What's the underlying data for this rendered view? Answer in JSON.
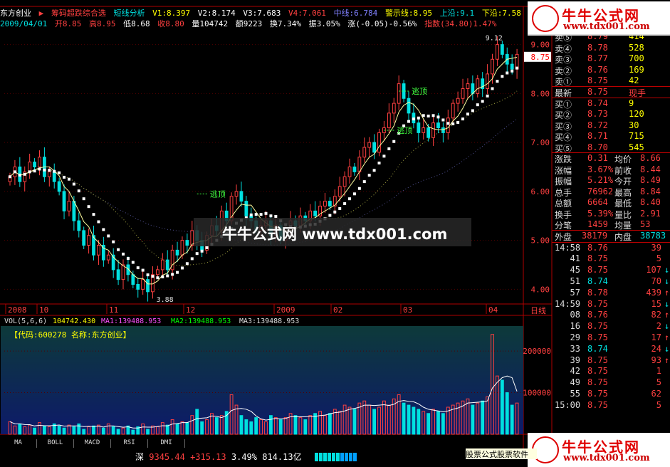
{
  "header": {
    "stock_name": "东方创业",
    "indicator_name": "筹码超跌综合选",
    "indicator_sub": "短线分析",
    "v1": "V1:8.397",
    "v2": "V2:8.174",
    "v3": "V3:7.683",
    "v4": "V4:7.061",
    "mid": "中线:6.784",
    "alert": "警示线:8.95",
    "upper": "上沿:9.1",
    "lower": "下沿:7.58",
    "date": "2009/04/01",
    "open": "开8.85",
    "high": "高8.95",
    "low": "低8.68",
    "close": "收8.80",
    "volume": "量104742",
    "amount": "额9223",
    "turnover": "换7.34%",
    "amplitude": "振3.05%",
    "change": "涨(-0.05)-0.56%",
    "index": "指数(34.80)1.47%"
  },
  "price_axis": {
    "ticks": [
      "9.00",
      "8.00",
      "7.00",
      "6.00",
      "5.00",
      "4.00"
    ],
    "current_tag": "8.75"
  },
  "annotations": {
    "sell_label": "逃顶",
    "high_label": "9.12",
    "low_label": "3.88"
  },
  "time_axis": {
    "labels": [
      "2008",
      "10",
      "11",
      "12",
      "2009",
      "02",
      "03",
      "04"
    ],
    "period": "日线"
  },
  "volume_header": {
    "vol": "VOL(5,6,6)",
    "vol_val": "104742.430",
    "ma1": "MA1:139488.953",
    "ma2": "MA2:139488.953",
    "ma3": "MA3:139488.953"
  },
  "volume_info": "【代码:600278 名称:东方创业】",
  "volume_axis": [
    "200000",
    "100000"
  ],
  "quote": {
    "asks": [
      {
        "label": "卖⑤",
        "price": "8.79",
        "vol": "414"
      },
      {
        "label": "卖④",
        "price": "8.78",
        "vol": "528"
      },
      {
        "label": "卖③",
        "price": "8.77",
        "vol": "700"
      },
      {
        "label": "卖②",
        "price": "8.76",
        "vol": "169"
      },
      {
        "label": "卖①",
        "price": "8.75",
        "vol": "42"
      }
    ],
    "last": {
      "label": "最新",
      "price": "8.75",
      "extra": "现手"
    },
    "bids": [
      {
        "label": "买①",
        "price": "8.74",
        "vol": "9"
      },
      {
        "label": "买②",
        "price": "8.73",
        "vol": "120"
      },
      {
        "label": "买③",
        "price": "8.72",
        "vol": "30"
      },
      {
        "label": "买④",
        "price": "8.71",
        "vol": "715"
      },
      {
        "label": "买⑤",
        "price": "8.70",
        "vol": "545"
      }
    ],
    "stats": [
      {
        "l1": "涨跌",
        "v1": "0.31",
        "l2": "均价",
        "v2": "8.66"
      },
      {
        "l1": "涨幅",
        "v1": "3.67%",
        "l2": "前收",
        "v2": "8.44"
      },
      {
        "l1": "振幅",
        "v1": "5.21%",
        "l2": "今开",
        "v2": "8.49"
      },
      {
        "l1": "总手",
        "v1": "76962",
        "l2": "最高",
        "v2": "8.84"
      },
      {
        "l1": "总额",
        "v1": "6664",
        "l2": "最低",
        "v2": "8.40"
      },
      {
        "l1": "换手",
        "v1": "5.39%",
        "l2": "量比",
        "v2": "2.91"
      },
      {
        "l1": "分笔",
        "v1": "1459",
        "l2": "均量",
        "v2": "53"
      }
    ],
    "outer": {
      "l1": "外盘",
      "v1": "38179",
      "l2": "内盘",
      "v2": "38783"
    },
    "ticks": [
      {
        "t": "14:58",
        "p": "8.76",
        "v": "39",
        "d": ""
      },
      {
        "t": "41",
        "p": "8.75",
        "v": "5",
        "d": ""
      },
      {
        "t": "45",
        "p": "8.75",
        "v": "107",
        "d": "↓"
      },
      {
        "t": "51",
        "p": "8.74",
        "v": "70",
        "d": "↓"
      },
      {
        "t": "57",
        "p": "8.78",
        "v": "439",
        "d": "↑"
      },
      {
        "t": "14:59",
        "p": "8.75",
        "v": "15",
        "d": "↓"
      },
      {
        "t": "08",
        "p": "8.76",
        "v": "82",
        "d": "↑"
      },
      {
        "t": "16",
        "p": "8.75",
        "v": "2",
        "d": "↓"
      },
      {
        "t": "29",
        "p": "8.75",
        "v": "17",
        "d": "↑"
      },
      {
        "t": "33",
        "p": "8.74",
        "v": "24",
        "d": "↓"
      },
      {
        "t": "39",
        "p": "8.75",
        "v": "93",
        "d": "↑"
      },
      {
        "t": "42",
        "p": "8.75",
        "v": "1",
        "d": ""
      },
      {
        "t": "49",
        "p": "8.75",
        "v": "5",
        "d": ""
      },
      {
        "t": "55",
        "p": "8.75",
        "v": "62",
        "d": ""
      },
      {
        "t": "15:00",
        "p": "8.75",
        "v": "5",
        "d": ""
      }
    ]
  },
  "logo": {
    "title": "牛牛公式网",
    "url": "www.tdx001.com"
  },
  "watermark": "牛牛公式网 www.tdx001.com",
  "tabs": [
    "MA",
    "BOLL",
    "MACD",
    "RSI",
    "DMI"
  ],
  "status": {
    "market": "深",
    "index": "9345.44",
    "change": "+315.13",
    "pct": "3.49%",
    "amount": "814.13亿"
  },
  "ad": "股票公式股票软件",
  "colors": {
    "up": "#ff4040",
    "down": "#00e0e0",
    "axis": "#b00000",
    "ma": "#ffff00"
  },
  "chart_data": {
    "type": "candlestick",
    "ylim": [
      3.7,
      9.3
    ],
    "closes": [
      6.3,
      6.5,
      6.2,
      6.4,
      6.6,
      6.5,
      6.7,
      6.3,
      6.4,
      6.2,
      6.0,
      5.6,
      5.8,
      5.4,
      5.2,
      4.9,
      5.1,
      4.7,
      4.9,
      4.6,
      4.7,
      4.4,
      4.2,
      4.5,
      4.3,
      4.1,
      4.0,
      4.2,
      3.95,
      4.3,
      4.4,
      4.6,
      4.4,
      4.8,
      4.7,
      5.0,
      4.9,
      5.2,
      5.0,
      4.8,
      5.1,
      5.3,
      5.2,
      5.6,
      5.4,
      5.9,
      6.0,
      5.8,
      5.5,
      5.4,
      5.2,
      5.3,
      5.4,
      5.1,
      5.3,
      5.0,
      5.2,
      5.4,
      5.3,
      5.5,
      5.4,
      5.6,
      5.5,
      5.7,
      5.8,
      5.7,
      5.9,
      6.1,
      6.3,
      6.5,
      6.4,
      6.7,
      6.9,
      7.0,
      6.8,
      7.2,
      7.3,
      7.6,
      7.8,
      8.2,
      7.9,
      7.6,
      7.4,
      7.2,
      7.3,
      7.1,
      7.4,
      7.3,
      7.2,
      7.5,
      7.8,
      7.9,
      8.1,
      8.2,
      8.0,
      8.3,
      8.1,
      8.4,
      8.7,
      9.0,
      8.8,
      8.6,
      8.5,
      8.8
    ],
    "volumes": [
      30,
      20,
      25,
      18,
      22,
      15,
      28,
      20,
      18,
      25,
      20,
      15,
      22,
      18,
      25,
      12,
      18,
      20,
      22,
      15,
      25,
      18,
      12,
      15,
      20,
      10,
      18,
      25,
      12,
      20,
      18,
      28,
      22,
      35,
      25,
      30,
      28,
      45,
      60,
      30,
      35,
      50,
      40,
      45,
      55,
      95,
      70,
      45,
      35,
      30,
      40,
      35,
      30,
      45,
      40,
      35,
      40,
      50,
      45,
      40,
      35,
      45,
      50,
      55,
      45,
      50,
      60,
      55,
      70,
      65,
      60,
      75,
      80,
      70,
      60,
      65,
      80,
      70,
      85,
      95,
      75,
      70,
      65,
      60,
      55,
      50,
      60,
      55,
      50,
      65,
      70,
      75,
      80,
      85,
      70,
      75,
      80,
      90,
      240,
      140,
      130,
      100,
      70,
      75
    ]
  }
}
